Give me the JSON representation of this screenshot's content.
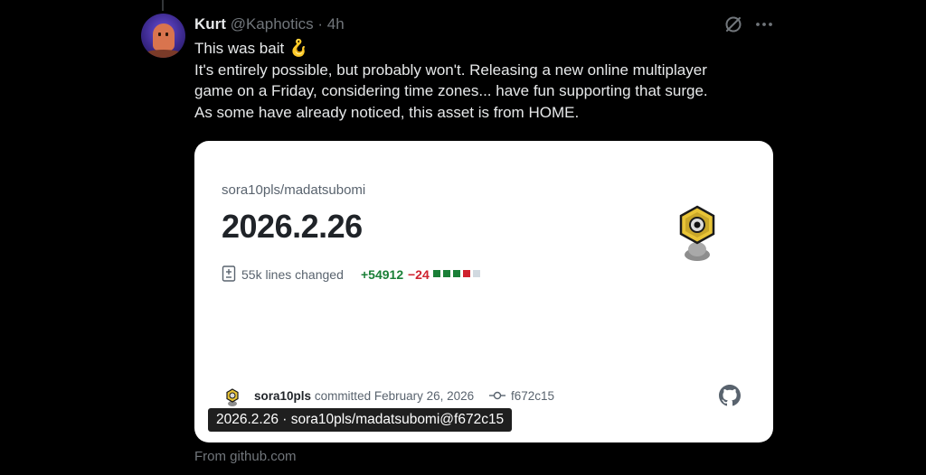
{
  "tweet": {
    "author_name": "Kurt",
    "handle": "@Kaphotics",
    "separator": "·",
    "time": "4h",
    "lines": [
      "This was bait",
      "It's entirely possible, but probably won't. Releasing a new online multiplayer",
      "game on a Friday, considering time zones... have fun supporting that surge.",
      "As some have already noticed, this asset is from HOME."
    ],
    "emoji": "🪝"
  },
  "card": {
    "repo": "sora10pls/madatsubomi",
    "release": "2026.2.26",
    "lines_changed": "55k lines changed",
    "additions": "+54912",
    "deletions": "−24",
    "diff_bar_colors": [
      "#1a7f37",
      "#1a7f37",
      "#1a7f37",
      "#cf222e",
      "#d1d9e0"
    ],
    "committer": "sora10pls",
    "committed_text": "committed February 26, 2026",
    "sha": "f672c15",
    "tooltip": "2026.2.26 · sora10pls/madatsubomi@f672c15"
  },
  "source": "From github.com",
  "icons": {
    "grok": "grok-icon",
    "more": "more-icon",
    "diff": "file-diff-icon",
    "commit": "git-commit-icon",
    "github": "github-icon"
  },
  "colors": {
    "background": "#000000",
    "card_background": "#ffffff",
    "addition": "#1a7f37",
    "deletion": "#cf222e",
    "muted": "#71767b"
  }
}
